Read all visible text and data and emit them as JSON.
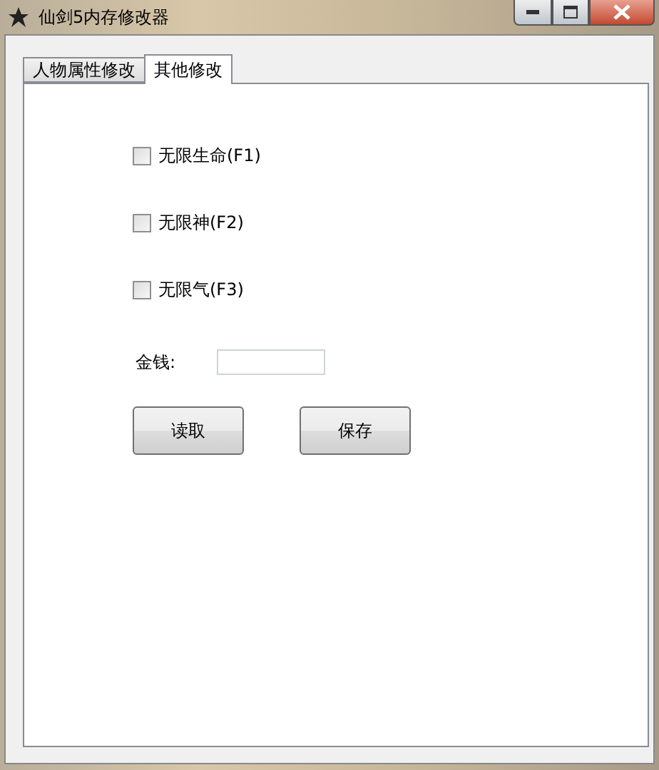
{
  "window": {
    "title": "仙剑5内存修改器"
  },
  "tabs": [
    {
      "label": "人物属性修改",
      "selected": false
    },
    {
      "label": "其他修改",
      "selected": true
    }
  ],
  "options": [
    {
      "label": "无限生命(F1)",
      "checked": false
    },
    {
      "label": "无限神(F2)",
      "checked": false
    },
    {
      "label": "无限气(F3)",
      "checked": false
    }
  ],
  "money": {
    "label": "金钱:"
  },
  "buttons": [
    "读取",
    "保存"
  ]
}
